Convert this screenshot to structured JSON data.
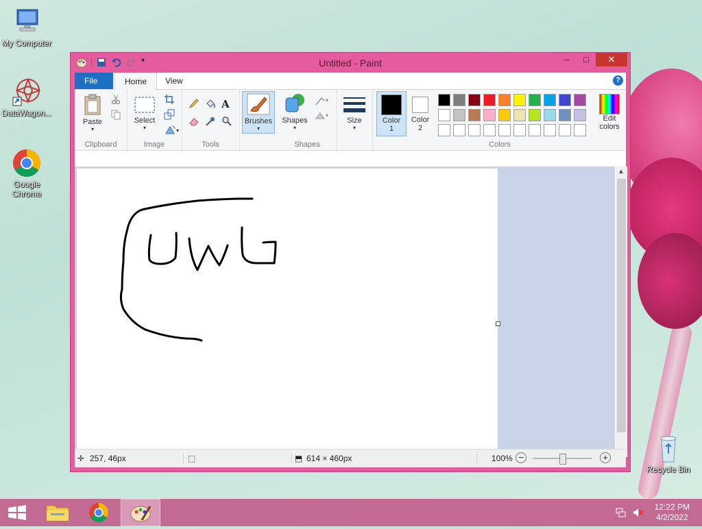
{
  "desktop": {
    "icons": [
      {
        "label": "My Computer"
      },
      {
        "label": "DataWagon..."
      },
      {
        "label": "Google Chrome"
      },
      {
        "label": "Recycle Bin"
      }
    ]
  },
  "window": {
    "title": "Untitled - Paint",
    "controls": {
      "minimize": "–",
      "maximize": "□",
      "close": "✕"
    }
  },
  "ribbon": {
    "tabs": [
      "File",
      "Home",
      "View"
    ],
    "help": "?",
    "groups": {
      "clipboard": {
        "label": "Clipboard",
        "paste": "Paste"
      },
      "image": {
        "label": "Image",
        "select": "Select"
      },
      "tools": {
        "label": "Tools"
      },
      "brushes": {
        "label": "Brushes"
      },
      "shapes": {
        "label": "Shapes",
        "shapes_btn": "Shapes"
      },
      "size": {
        "label": "Size"
      },
      "colors": {
        "label": "Colors",
        "color1": "Color 1",
        "color1_line1": "Color",
        "color1_line2": "1",
        "color2_line1": "Color",
        "color2_line2": "2",
        "edit": "Edit colors",
        "edit_line1": "Edit",
        "edit_line2": "colors",
        "palette_row1": [
          "#000000",
          "#7f7f7f",
          "#880015",
          "#ed1c24",
          "#ff7f27",
          "#fff200",
          "#22b14c",
          "#00a2e8",
          "#3f48cc",
          "#a349a4"
        ],
        "palette_row2": [
          "#ffffff",
          "#c3c3c3",
          "#b97a57",
          "#ffaec9",
          "#ffc90e",
          "#efe4b0",
          "#b5e61d",
          "#99d9ea",
          "#7092be",
          "#c8bfe7"
        ],
        "palette_row3": [
          "#ffffff",
          "#ffffff",
          "#ffffff",
          "#ffffff",
          "#ffffff",
          "#ffffff",
          "#ffffff",
          "#ffffff",
          "#ffffff",
          "#ffffff"
        ]
      }
    }
  },
  "statusbar": {
    "cursor_pos": "257, 46px",
    "canvas_size": "614 × 460px",
    "zoom": "100%",
    "zoom_minus": "−",
    "zoom_plus": "+"
  },
  "taskbar": {
    "time": "12:22 PM",
    "date": "4/2/2022"
  },
  "colors": {
    "window_frame": "#e45c9e",
    "file_tab": "#1e6fc6",
    "taskbar": "#c26a92",
    "close_button": "#c7372f"
  }
}
